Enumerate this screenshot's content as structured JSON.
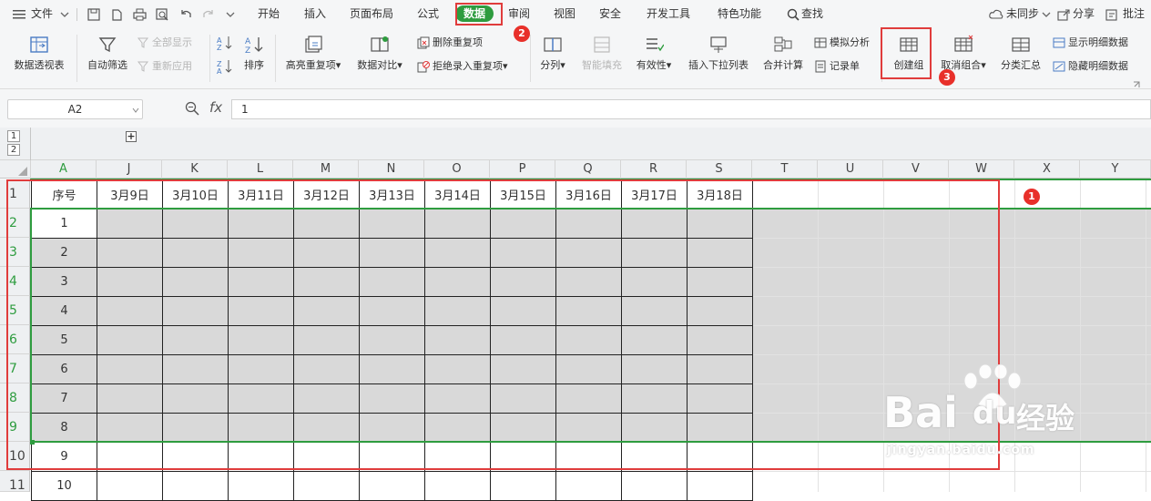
{
  "menu": {
    "file": "文件",
    "tabs": [
      "开始",
      "插入",
      "页面布局",
      "公式",
      "数据",
      "审阅",
      "视图",
      "安全",
      "开发工具",
      "特色功能"
    ],
    "active_tab": "数据",
    "search": "查找",
    "sync": "未同步",
    "share": "分享",
    "comment": "批注"
  },
  "ribbon": {
    "pivot": "数据透视表",
    "autofilter": "自动筛选",
    "show_all": "全部显示",
    "reapply": "重新应用",
    "sort": "排序",
    "highlight_dup": "高亮重复项",
    "compare": "数据对比",
    "delete_dup": "删除重复项",
    "reject_dup": "拒绝录入重复项",
    "split": "分列",
    "smart_fill": "智能填充",
    "validity": "有效性",
    "insert_dropdown": "插入下拉列表",
    "consolidate": "合并计算",
    "simulation": "模拟分析",
    "record": "记录单",
    "create_group": "创建组",
    "ungroup": "取消组合",
    "subtotal": "分类汇总",
    "show_detail": "显示明细数据",
    "hide_detail": "隐藏明细数据"
  },
  "formula": {
    "cell_ref": "A2",
    "fx": "fx",
    "value": "1"
  },
  "outline": {
    "level1": "1",
    "level2": "2",
    "plus": "+"
  },
  "columns": [
    "A",
    "J",
    "K",
    "L",
    "M",
    "N",
    "O",
    "P",
    "Q",
    "R",
    "S",
    "T",
    "U",
    "V",
    "W",
    "X",
    "Y"
  ],
  "rows": [
    "1",
    "2",
    "3",
    "4",
    "5",
    "6",
    "7",
    "8",
    "9",
    "10",
    "11"
  ],
  "table": {
    "header": [
      "序号",
      "3月9日",
      "3月10日",
      "3月11日",
      "3月12日",
      "3月13日",
      "3月14日",
      "3月15日",
      "3月16日",
      "3月17日",
      "3月18日"
    ],
    "serials": [
      "1",
      "2",
      "3",
      "4",
      "5",
      "6",
      "7",
      "8",
      "9",
      "10"
    ]
  },
  "annotations": {
    "badge1": "1",
    "badge2": "2",
    "badge3": "3",
    "color": "#e8302a"
  },
  "watermark": {
    "brand": "Bai",
    "brand_du": "du",
    "cn": "经验",
    "url": "jingyan.baidu.com"
  },
  "colors": {
    "accent_green": "#2e9c3f",
    "selection_fill": "#d9d9d9",
    "red_box": "#e03c3c"
  }
}
